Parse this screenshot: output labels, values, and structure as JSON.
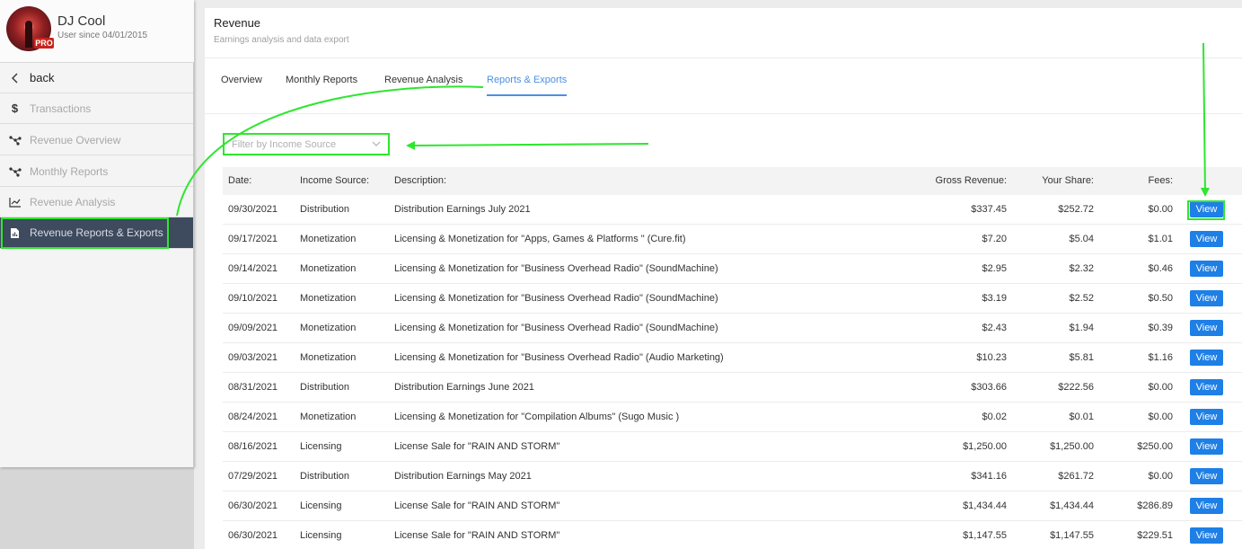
{
  "profile": {
    "name": "DJ Cool",
    "since": "User since 04/01/2015",
    "badge": "PRO"
  },
  "sidebar": {
    "items": [
      {
        "label": "back",
        "icon": "chevron-left-icon"
      },
      {
        "label": "Transactions",
        "icon": "dollar-icon"
      },
      {
        "label": "Revenue Overview",
        "icon": "network-icon"
      },
      {
        "label": "Monthly Reports",
        "icon": "network-icon"
      },
      {
        "label": "Revenue Analysis",
        "icon": "line-chart-icon"
      },
      {
        "label": "Revenue Reports & Exports",
        "icon": "document-icon"
      }
    ]
  },
  "header": {
    "title": "Revenue",
    "subtitle": "Earnings analysis and data export"
  },
  "tabs": [
    {
      "label": "Overview"
    },
    {
      "label": "Monthly Reports"
    },
    {
      "label": "Revenue Analysis"
    },
    {
      "label": "Reports & Exports",
      "active": true
    }
  ],
  "filter": {
    "placeholder": "Filter by Income Source"
  },
  "table": {
    "headers": {
      "date": "Date:",
      "source": "Income Source:",
      "description": "Description:",
      "gross": "Gross Revenue:",
      "share": "Your Share:",
      "fees": "Fees:"
    },
    "view_label": "View",
    "rows": [
      {
        "date": "09/30/2021",
        "source": "Distribution",
        "description": "Distribution Earnings July 2021",
        "gross": "$337.45",
        "share": "$252.72",
        "fees": "$0.00"
      },
      {
        "date": "09/17/2021",
        "source": "Monetization",
        "description": "Licensing & Monetization for \"Apps, Games & Platforms \" (Cure.fit)",
        "gross": "$7.20",
        "share": "$5.04",
        "fees": "$1.01"
      },
      {
        "date": "09/14/2021",
        "source": "Monetization",
        "description": "Licensing & Monetization for \"Business Overhead Radio\" (SoundMachine)",
        "gross": "$2.95",
        "share": "$2.32",
        "fees": "$0.46"
      },
      {
        "date": "09/10/2021",
        "source": "Monetization",
        "description": "Licensing & Monetization for \"Business Overhead Radio\" (SoundMachine)",
        "gross": "$3.19",
        "share": "$2.52",
        "fees": "$0.50"
      },
      {
        "date": "09/09/2021",
        "source": "Monetization",
        "description": "Licensing & Monetization for \"Business Overhead Radio\" (SoundMachine)",
        "gross": "$2.43",
        "share": "$1.94",
        "fees": "$0.39"
      },
      {
        "date": "09/03/2021",
        "source": "Monetization",
        "description": "Licensing & Monetization for \"Business Overhead Radio\" (Audio Marketing)",
        "gross": "$10.23",
        "share": "$5.81",
        "fees": "$1.16"
      },
      {
        "date": "08/31/2021",
        "source": "Distribution",
        "description": "Distribution Earnings June 2021",
        "gross": "$303.66",
        "share": "$222.56",
        "fees": "$0.00"
      },
      {
        "date": "08/24/2021",
        "source": "Monetization",
        "description": "Licensing & Monetization for \"Compilation Albums\" (Sugo Music )",
        "gross": "$0.02",
        "share": "$0.01",
        "fees": "$0.00"
      },
      {
        "date": "08/16/2021",
        "source": "Licensing",
        "description": "License Sale for \"RAIN AND STORM\"",
        "gross": "$1,250.00",
        "share": "$1,250.00",
        "fees": "$250.00"
      },
      {
        "date": "07/29/2021",
        "source": "Distribution",
        "description": "Distribution Earnings May 2021",
        "gross": "$341.16",
        "share": "$261.72",
        "fees": "$0.00"
      },
      {
        "date": "06/30/2021",
        "source": "Licensing",
        "description": "License Sale for \"RAIN AND STORM\"",
        "gross": "$1,434.44",
        "share": "$1,434.44",
        "fees": "$286.89"
      },
      {
        "date": "06/30/2021",
        "source": "Licensing",
        "description": "License Sale for \"RAIN AND STORM\"",
        "gross": "$1,147.55",
        "share": "$1,147.55",
        "fees": "$229.51"
      }
    ]
  },
  "colors": {
    "accent": "#4a90e2",
    "button": "#1e7fe6",
    "sidebar_active": "#3e4a5e",
    "annotation": "#2ee62e"
  }
}
